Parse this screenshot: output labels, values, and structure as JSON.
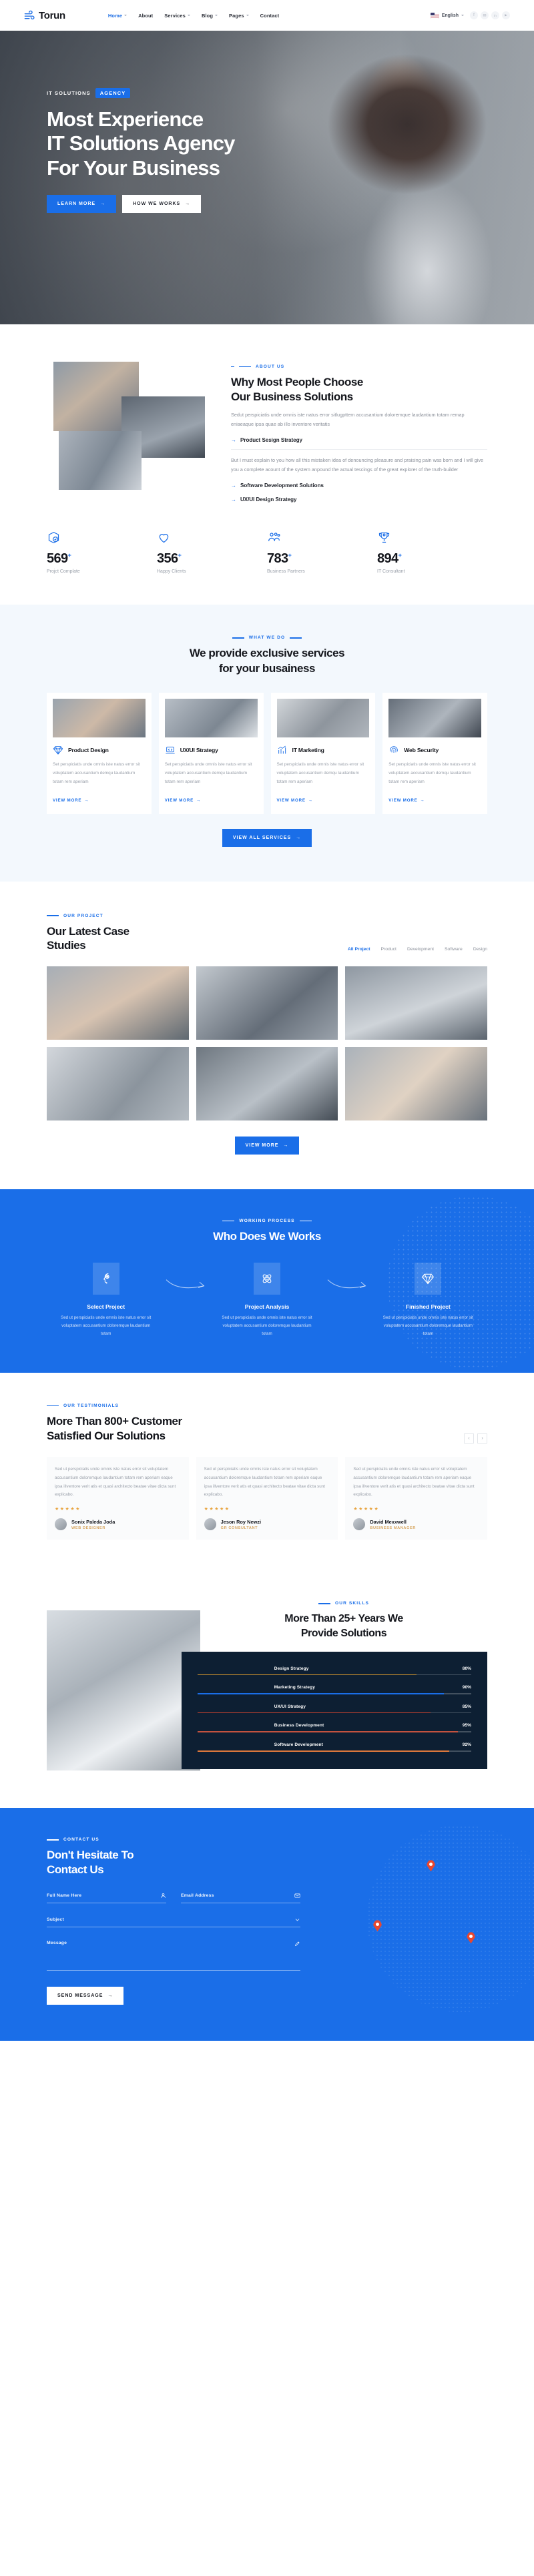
{
  "header": {
    "brand": "Torun",
    "brand_icon": "wind-logo-icon",
    "nav": [
      {
        "label": "Home",
        "has_caret": true,
        "active": true
      },
      {
        "label": "About",
        "has_caret": false,
        "active": false
      },
      {
        "label": "Services",
        "has_caret": true,
        "active": false
      },
      {
        "label": "Blog",
        "has_caret": true,
        "active": false
      },
      {
        "label": "Pages",
        "has_caret": true,
        "active": false
      },
      {
        "label": "Contact",
        "has_caret": false,
        "active": false
      }
    ],
    "language": "English",
    "language_flag": "us-flag-icon",
    "social": [
      {
        "name": "facebook-icon",
        "glyph": "f"
      },
      {
        "name": "twitter-icon",
        "glyph": "✉"
      },
      {
        "name": "linkedin-icon",
        "glyph": "in"
      },
      {
        "name": "youtube-icon",
        "glyph": "▶"
      }
    ]
  },
  "hero": {
    "eyebrow_light": "IT SOLUTIONS",
    "eyebrow_pill": "AGENCY",
    "title_line1": "Most Experience",
    "title_line2": "IT Solutions Agency",
    "title_line3": "For Your Business",
    "btn_primary": "LEARN MORE",
    "btn_secondary": "HOW WE WORKS"
  },
  "about": {
    "tagline": "ABOUT US",
    "title_line1": "Why Most People Choose",
    "title_line2": "Our Business Solutions",
    "intro": "Sedut perspiciatis unde omnis iste natus error sitlugpttem accusantium doloremque laudantium totam remap eniaeaque ipsa quae ab illo inventore veritatis",
    "feature_1": "Product Sesign Strategy",
    "detail": "But I must explain to you how all this mistaken idea of denouncing pleasure and praising pain was born and I will give you a complete acount of the system anpound the actual tescings of the great explorer of the truth-builder",
    "feature_2": "Software Development Solutions",
    "feature_3": "UX/UI Design Strategy"
  },
  "stats": [
    {
      "icon": "box-check-icon",
      "value": "569",
      "plus": "+",
      "label": "Projct Complate"
    },
    {
      "icon": "heart-icon",
      "value": "356",
      "plus": "+",
      "label": "Happy Clients"
    },
    {
      "icon": "people-group-icon",
      "value": "783",
      "plus": "+",
      "label": "Business Partners"
    },
    {
      "icon": "trophy-icon",
      "value": "894",
      "plus": "+",
      "label": "IT Consultant"
    }
  ],
  "services": {
    "tagline": "WHAT WE DO",
    "title_line1": "We provide exclusive services",
    "title_line2": "for your busainess",
    "view_more": "VIEW MORE",
    "all_services_btn": "VIEW ALL SERVICES",
    "cards": [
      {
        "icon": "diamond-icon",
        "title": "Product Design",
        "text": "Set perspiciatis unde omnis iste natus error sit voluptatem accusantium demqu laudantium totam rem aperiam"
      },
      {
        "icon": "laptop-code-icon",
        "title": "UX/UI Strategy",
        "text": "Set perspiciatis unde omnis iste natus error sit voluptatem accusantium demqu laudantium totam rem aperiam"
      },
      {
        "icon": "bar-chart-icon",
        "title": "IT Marketing",
        "text": "Set perspiciatis unde omnis iste natus error sit voluptatem accusantium demqu laudantium totam rem aperiam"
      },
      {
        "icon": "fingerprint-icon",
        "title": "Web Security",
        "text": "Set perspiciatis unde omnis iste natus error sit voluptatem accusantium demqu laudantium totam rem aperiam"
      }
    ]
  },
  "projects": {
    "tagline": "OUR PROJECT",
    "title_line1": "Our Latest Case",
    "title_line2": "Studies",
    "filters": [
      {
        "label": "All Project",
        "active": true
      },
      {
        "label": "Product",
        "active": false
      },
      {
        "label": "Development",
        "active": false
      },
      {
        "label": "Software",
        "active": false
      },
      {
        "label": "Design",
        "active": false
      }
    ],
    "view_more_btn": "VIEW MORE"
  },
  "process": {
    "tagline": "WORKING PROCESS",
    "title": "Who Does We Works",
    "steps": [
      {
        "icon": "brain-head-icon",
        "title": "Select Project",
        "text": "Sed ut perspiciatis unde omnis iste natus error sit voluptatem accusantium doloremque laudantium totam"
      },
      {
        "icon": "atom-icon",
        "title": "Project Analysis",
        "text": "Sed ut perspiciatis unde omnis iste natus error sit voluptatem accusantium doloremque laudantium totam"
      },
      {
        "icon": "diamond-icon",
        "title": "Finished Project",
        "text": "Sed ut perspiciatis unde omnis iste natus error sit voluptatem accusantium doloremque laudantium totam"
      }
    ]
  },
  "testimonials": {
    "tagline": "OUR TESTIMONIALS",
    "title_line1": "More Than 800+ Customer",
    "title_line2": "Satisfied Our Solutions",
    "prev_icon": "chevron-left-icon",
    "next_icon": "chevron-right-icon",
    "cards": [
      {
        "text": "Sed ut perspiciatis unde omnis iste natus error sit voluptatem accusantium doloremque laudantium totam rem aperiam eaque ipsa illventore verit atis et quasi architecto beatae vitae dicta sunt explicabo.",
        "stars": "★★★★★",
        "name": "Sonix Paleda Joda",
        "role": "WEB DESIGNER"
      },
      {
        "text": "Sed ut perspiciatis unde omnis iste natus error sit voluptatem accusantium doloremque laudantium totam rem aperiam eaque ipsa illventore verit atis et quasi architecto beatae vitae dicta sunt explicabo.",
        "stars": "★★★★★",
        "name": "Jeson Roy Newzi",
        "role": "GR CONSULTANT"
      },
      {
        "text": "Sed ut perspiciatis unde omnis iste natus error sit voluptatem accusantium doloremque laudantium totam rem aperiam eaque ipsa illventore verit atis et quasi architecto beatae vitae dicta sunt explicabo.",
        "stars": "★★★★★",
        "name": "David Mexxwell",
        "role": "BUSINESS MANAGER"
      }
    ]
  },
  "skills": {
    "tagline": "OUR SKILLS",
    "title_line1": "More Than 25+ Years We",
    "title_line2": "Provide Solutions"
  },
  "chart_data": {
    "type": "bar",
    "title": "More Than 25+ Years We Provide Solutions",
    "orientation": "horizontal",
    "categories": [
      "Design Strategy",
      "Marketing Strategy",
      "UX/UI Strategy",
      "Business Development",
      "Software Development"
    ],
    "values": [
      80,
      90,
      85,
      95,
      92
    ],
    "value_labels": [
      "80%",
      "90%",
      "85%",
      "95%",
      "92%"
    ],
    "colors": [
      "#c08a2e",
      "#1a6ee8",
      "#c2412f",
      "#c2523f",
      "#e07a3c"
    ],
    "xlim": [
      0,
      100
    ],
    "ylabel": "",
    "xlabel": "",
    "grid": false,
    "legend": false,
    "background": "#0d1f33"
  },
  "contact": {
    "tagline": "CONTACT US",
    "title_line1": "Don't Hesitate To",
    "title_line2": "Contact Us",
    "name_placeholder": "Full Name Here",
    "name_icon": "user-icon",
    "email_placeholder": "Email Address",
    "email_icon": "envelope-icon",
    "subject_placeholder": "Subject",
    "subject_icon": "chevron-down-icon",
    "message_placeholder": "Message",
    "message_icon": "pencil-icon",
    "send_label": "SEND MESSAGE"
  },
  "colors": {
    "accent": "#1a6ee8",
    "dark": "#0d1f33",
    "text": "#14161c",
    "muted": "#9aa0aa",
    "star": "#e8a33d",
    "role": "#d6a45d",
    "pin": "#e8472f"
  }
}
